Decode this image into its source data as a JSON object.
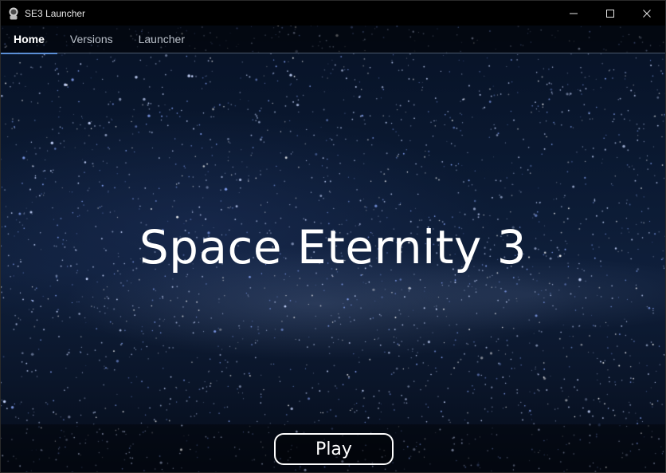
{
  "window": {
    "title": "SE3 Launcher",
    "icon": "astronaut-icon",
    "controls": [
      "minimize-icon",
      "maximize-icon",
      "close-icon"
    ]
  },
  "tabs": [
    {
      "label": "Home",
      "active": true
    },
    {
      "label": "Versions",
      "active": false
    },
    {
      "label": "Launcher",
      "active": false
    }
  ],
  "main": {
    "game_title": "Space Eternity 3",
    "play_label": "Play"
  },
  "colors": {
    "tab_indicator": "#5b8fd6",
    "background_top": "#071226",
    "background_mid": "#0f1f3b"
  }
}
